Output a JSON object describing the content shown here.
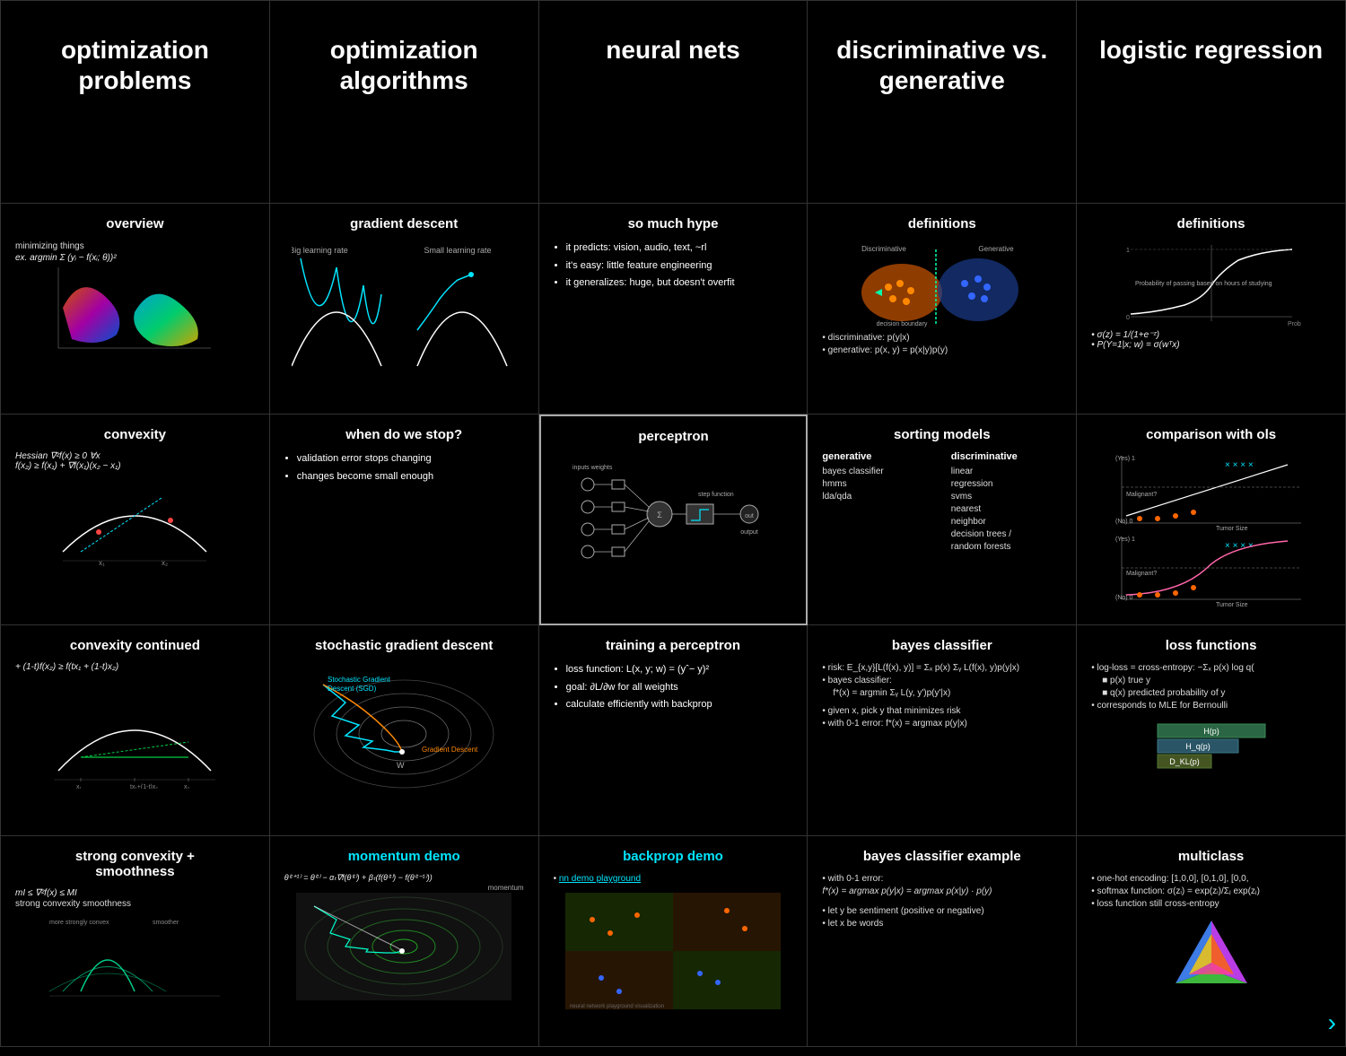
{
  "cells": {
    "r1c1": {
      "title": "optimization\nproblems"
    },
    "r1c2": {
      "title": "optimization\nalgorithms"
    },
    "r1c3": {
      "title": "neural nets"
    },
    "r1c4": {
      "title": "discriminative vs.\ngenerative"
    },
    "r1c5": {
      "title": "logistic regression"
    },
    "r2c1_title": "overview",
    "r2c1_text1": "minimizing things",
    "r2c1_text2": "ex. argmin Σ (yᵢ − f(xᵢ; θ))²",
    "r2c2_title": "gradient descent",
    "r2c2_sub": "Big learning rate    Small learning rate",
    "r2c3_title": "so much hype",
    "r2c3_bullets": [
      "it predicts: vision, audio, text, ~rl",
      "it's easy: little feature engineering",
      "it generalizes: huge, but doesn't overfit"
    ],
    "r2c4_title": "definitions",
    "r2c4_b1": "discriminative: p(y|x)",
    "r2c4_b2": "generative: p(x, y) = p(x|y)p(y)",
    "r2c5_title": "definitions",
    "r2c5_f1": "σ(z) = 1/(1+e⁻ᶻ)",
    "r2c5_f2": "P(Y=1|x; w) = σ(wᵀx)",
    "r3c1_title": "convexity",
    "r3c1_f1": "Hessian ∇²f(x) ≥ 0 ∀x",
    "r3c1_f2": "f(x₂) ≥ f(x₁) + ∇f(x₁)(x₂ − x₁)",
    "r3c2_title": "when do we stop?",
    "r3c2_b1": "validation error stops changing",
    "r3c2_b2": "changes become small enough",
    "r3c3_title": "perceptron",
    "r3c4_title": "sorting models",
    "r3c4_gen": "generative",
    "r3c4_gen_items": [
      "bayes classifier",
      "hmms",
      "lda/qda"
    ],
    "r3c4_disc": "discriminative",
    "r3c4_disc_items": [
      "linear",
      "regression",
      "svms",
      "nearest",
      "neighbor",
      "decision trees /",
      "random forests"
    ],
    "r3c5_title": "comparison with ols",
    "r4c1_title": "convexity continued",
    "r4c1_f1": "+ (1-t)f(x₂) ≥ f(tx₁ + (1-t)x₂)",
    "r4c2_title": "stochastic gradient descent",
    "r4c2_sub": "Stochastic Gradient Descent (SGD)",
    "r4c2_sub2": "Gradient Descent",
    "r4c3_title": "training a perceptron",
    "r4c3_b1": "loss function: L(x, y; w) = (yˆ− y)²",
    "r4c3_b2": "goal: ∂L/∂w for all weights",
    "r4c3_b3": "calculate efficiently with backprop",
    "r4c4_title": "bayes classifier",
    "r4c4_b1": "risk: E_{x,y}[L(f(x), y)] = Σₓ p(x) Σᵧ L(f(x), y)p(y|x)",
    "r4c4_b2": "bayes classifier:",
    "r4c4_b3": "f*(x) = argmin Σᵧ L(y, y')p(y'|x)",
    "r4c4_b4": "given x, pick y that minimizes risk",
    "r4c4_b5": "with 0-1 error: f*(x) = argmax p(y|x)",
    "r4c5_title": "loss functions",
    "r4c5_b1": "log-loss = cross-entropy: −Σₓ p(x) log q(",
    "r4c5_b2": "p(x) true y",
    "r4c5_b3": "q(x) predicted probability of y",
    "r4c5_b4": "corresponds to MLE for Bernoulli",
    "r5c1_title": "strong convexity +\nsmoothness",
    "r5c1_f1": "mI ≤ ∇²f(x) ≤ MI",
    "r5c1_f2": "strong convexity        smoothness",
    "r5c2_title": "momentum demo",
    "r5c2_f1": "θ⁽ᵗ⁺¹⁾ = θ⁽ᵗ⁾ − αₜ∇f(θ⁽ᵗ⁾) + βₜ(f(θ⁽ᵗ⁾) − f(θ⁽ᵗ⁻¹⁾))",
    "r5c2_sub": "momentum",
    "r5c3_title": "backprop demo",
    "r5c3_link": "nn demo playground",
    "r5c4_title": "bayes classifier example",
    "r5c4_b1": "with 0-1 error:",
    "r5c4_b2": "f*(x) = argmax p(y|x) = argmax p(x|y) · p(y)",
    "r5c4_b3": "let y be sentiment (positive or negative)",
    "r5c4_b4": "let x be words",
    "r5c5_title": "multiclass",
    "r5c5_b1": "one-hot encoding: [1,0,0], [0,1,0], [0,0,",
    "r5c5_b2": "softmax function: σ(zᵢ) = exp(zᵢ)/Σⱼ exp(zⱼ)",
    "r5c5_b3": "loss function still cross-entropy",
    "nav_arrow": "›"
  }
}
